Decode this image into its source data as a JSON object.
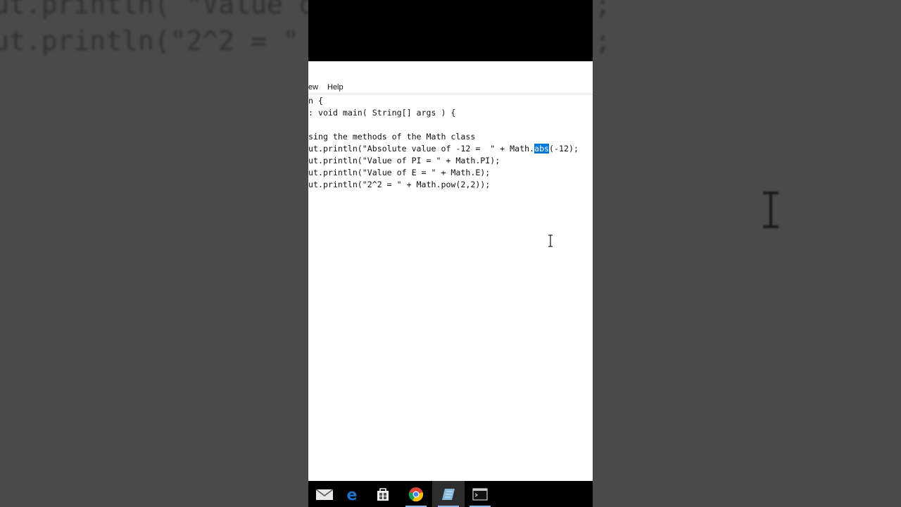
{
  "background": {
    "code_lines": [
      "ut.println( \"Value of",
      "ut.println(\"2^2 = \""
    ],
    "right_lines": [
      ";",
      ";"
    ]
  },
  "editor": {
    "menu": [
      "ew",
      "Help"
    ],
    "code_lines": [
      "n {",
      ": void main( String[] args ) {",
      "",
      "sing the methods of the Math class",
      "ut.println(\"Absolute value of -12 =  \" + Math.",
      "ut.println(\"Value of PI = \" + Math.PI);",
      "ut.println(\"Value of E = \" + Math.E);",
      "ut.println(\"2^2 = \" + Math.pow(2,2));"
    ],
    "selected_text": "abs",
    "after_selection": "(-12);"
  },
  "taskbar": {
    "icons": [
      "mail-icon",
      "edge-icon",
      "store-icon",
      "chrome-icon",
      "notepad-icon",
      "terminal-icon"
    ]
  },
  "colors": {
    "selection": "#0078d7",
    "edge_blue": "#1e73c9",
    "notepad_blue": "#86b8d9"
  }
}
